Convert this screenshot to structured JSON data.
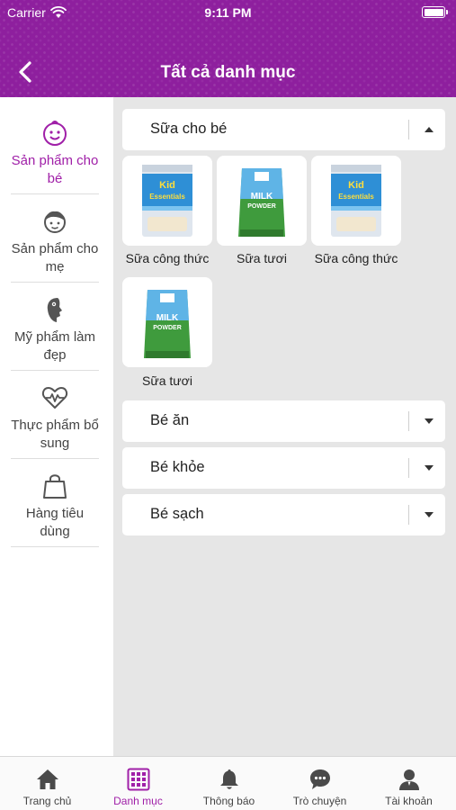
{
  "status_bar": {
    "carrier": "Carrier",
    "time": "9:11 PM"
  },
  "header": {
    "title": "Tất cả danh mục",
    "back_icon": "chevron-left-icon"
  },
  "colors": {
    "brand": "#8e1f9e",
    "active_text": "#a020a8",
    "content_bg": "#e6e6e6"
  },
  "sidebar": {
    "items": [
      {
        "label": "Sản phẩm cho bé",
        "icon": "baby-face-icon",
        "active": true
      },
      {
        "label": "Sản phẩm cho mẹ",
        "icon": "mother-face-icon",
        "active": false
      },
      {
        "label": "Mỹ phẩm làm đẹp",
        "icon": "woman-profile-icon",
        "active": false
      },
      {
        "label": "Thực phẩm bổ sung",
        "icon": "heart-pulse-icon",
        "active": false
      },
      {
        "label": "Hàng tiêu dùng",
        "icon": "shopping-bag-icon",
        "active": false
      }
    ]
  },
  "categories": [
    {
      "label": "Sữa cho bé",
      "expanded": true,
      "products": [
        {
          "name": "Sữa công thức",
          "image": "formula-milk-can"
        },
        {
          "name": "Sữa tươi",
          "image": "milk-powder-bag"
        },
        {
          "name": "Sữa công thức",
          "image": "formula-milk-can"
        },
        {
          "name": "Sữa tươi",
          "image": "milk-powder-bag"
        }
      ]
    },
    {
      "label": "Bé ăn",
      "expanded": false
    },
    {
      "label": "Bé khỏe",
      "expanded": false
    },
    {
      "label": "Bé sạch",
      "expanded": false
    }
  ],
  "tabbar": {
    "items": [
      {
        "label": "Trang chủ",
        "icon": "home-icon",
        "active": false
      },
      {
        "label": "Danh mục",
        "icon": "grid-icon",
        "active": true
      },
      {
        "label": "Thông báo",
        "icon": "bell-icon",
        "active": false
      },
      {
        "label": "Trò chuyện",
        "icon": "chat-bubble-icon",
        "active": false
      },
      {
        "label": "Tài khoản",
        "icon": "user-icon",
        "active": false
      }
    ]
  }
}
